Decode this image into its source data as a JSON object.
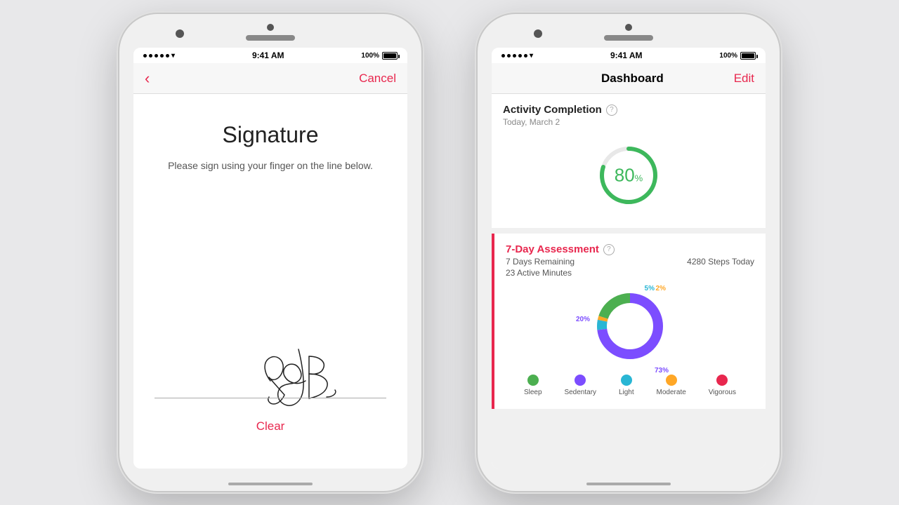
{
  "phone1": {
    "status": {
      "time": "9:41 AM",
      "battery": "100%"
    },
    "nav": {
      "back_icon": "‹",
      "cancel_label": "Cancel"
    },
    "signature": {
      "title": "Signature",
      "subtitle": "Please sign using your finger on the line\nbelow.",
      "clear_label": "Clear"
    }
  },
  "phone2": {
    "status": {
      "time": "9:41 AM",
      "battery": "100%"
    },
    "nav": {
      "title": "Dashboard",
      "edit_label": "Edit"
    },
    "activity_completion": {
      "title": "Activity Completion",
      "date": "Today, March 2",
      "percent": "80",
      "percent_symbol": "%"
    },
    "seven_day": {
      "title": "7-Day Assessment",
      "days_remaining": "7 Days Remaining",
      "active_minutes": "23 Active Minutes",
      "steps_today": "4280 Steps Today",
      "chart": {
        "segments": [
          {
            "label": "73%",
            "color": "#7c4dff",
            "value": 73
          },
          {
            "label": "20%",
            "color": "#7c4dff",
            "value": 20
          },
          {
            "label": "5%",
            "color": "#29b6d4",
            "value": 5
          },
          {
            "label": "2%",
            "color": "#ffa726",
            "value": 2
          }
        ]
      }
    },
    "legend": [
      {
        "label": "Sleep",
        "color": "#4caf50"
      },
      {
        "label": "Sedentary",
        "color": "#7c4dff"
      },
      {
        "label": "Light",
        "color": "#29b6d4"
      },
      {
        "label": "Moderate",
        "color": "#ffa726"
      },
      {
        "label": "Vigorous",
        "color": "#e8274e"
      }
    ]
  }
}
